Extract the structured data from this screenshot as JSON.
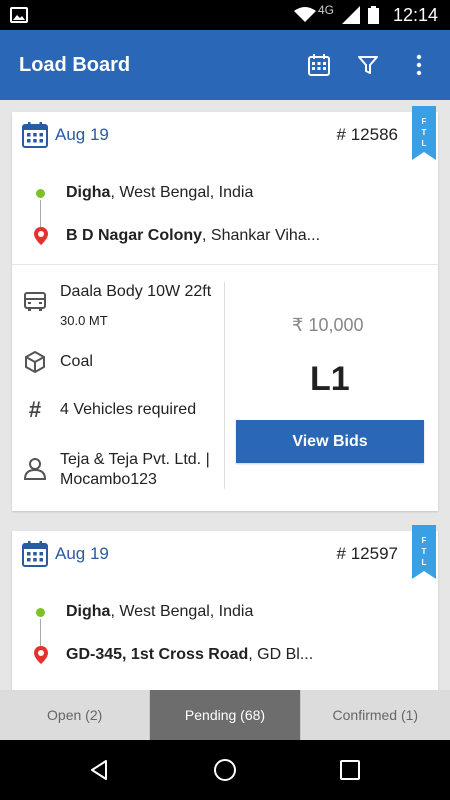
{
  "status_bar": {
    "network": "4G",
    "time": "12:14"
  },
  "app_bar": {
    "title": "Load Board"
  },
  "loads": [
    {
      "date": "Aug 19",
      "load_id": "# 12586",
      "badge": [
        "F",
        "T",
        "L"
      ],
      "origin_bold": "Digha",
      "origin_rest": ", West Bengal, India",
      "dest_bold": "B D Nagar Colony",
      "dest_rest": ", Shankar Viha...",
      "truck": "Daala Body 10W 22ft",
      "weight": "30.0 MT",
      "material": "Coal",
      "vehicles": "4 Vehicles required",
      "company_line1": "Teja & Teja Pvt. Ltd. |",
      "company_line2": "Mocambo123",
      "price": "₹ 10,000",
      "rank": "L1",
      "action": "View Bids"
    },
    {
      "date": "Aug 19",
      "load_id": "# 12597",
      "badge": [
        "F",
        "T",
        "L"
      ],
      "origin_bold": "Digha",
      "origin_rest": ", West Bengal, India",
      "dest_bold": "GD-345, 1st Cross Road",
      "dest_rest": ", GD Bl..."
    }
  ],
  "tabs": [
    {
      "label": "Open (2)",
      "active": false
    },
    {
      "label": "Pending (68)",
      "active": true
    },
    {
      "label": "Confirmed (1)",
      "active": false
    }
  ],
  "colors": {
    "primary": "#2a67b7",
    "badge": "#3aa0e6",
    "origin": "#7cc02a",
    "destination": "#e5322d"
  }
}
